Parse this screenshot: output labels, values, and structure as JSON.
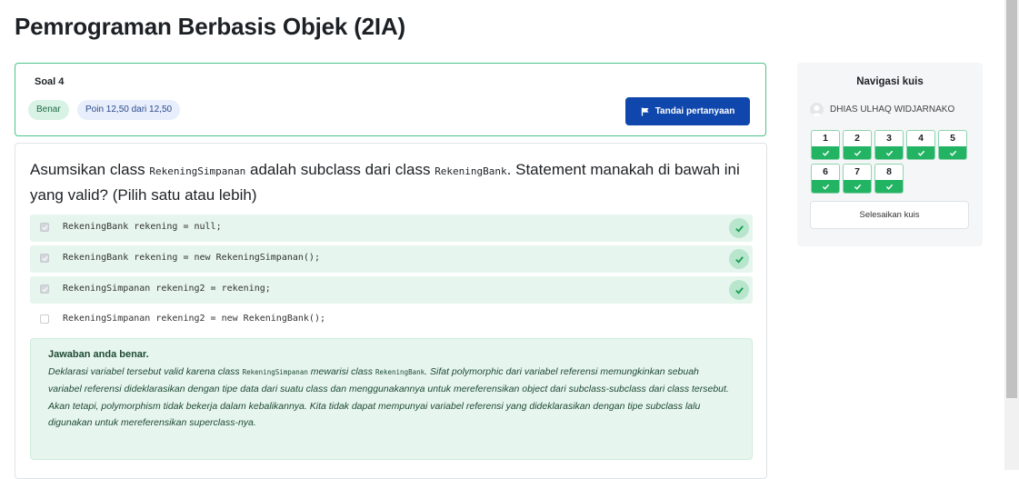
{
  "page": {
    "title": "Pemrograman Berbasis Objek (2IA)"
  },
  "question_info": {
    "number_label": "Soal 4",
    "status": "Benar",
    "points": "Poin 12,50 dari 12,50",
    "flag_label": "Tandai pertanyaan"
  },
  "question": {
    "text_before": "Asumsikan class ",
    "class1": "RekeningSimpanan",
    "text_middle": " adalah subclass dari class ",
    "class2": "RekeningBank",
    "text_after": ". Statement manakah di bawah ini yang valid? (Pilih satu atau lebih)",
    "options": [
      {
        "code": "RekeningBank rekening = null;",
        "checked": true,
        "correct": true
      },
      {
        "code": "RekeningBank rekening = new RekeningSimpanan();",
        "checked": true,
        "correct": true
      },
      {
        "code": "RekeningSimpanan rekening2 = rekening;",
        "checked": true,
        "correct": true
      },
      {
        "code": "RekeningSimpanan rekening2 = new RekeningBank();",
        "checked": false,
        "correct": false
      }
    ]
  },
  "feedback": {
    "title": "Jawaban anda benar.",
    "part1": "Deklarasi variabel tersebut valid karena class ",
    "code1": "RekeningSimpanan",
    "part2": " mewarisi class ",
    "code2": "RekeningBank",
    "part3": ". Sifat polymorphic dari variabel referensi memungkinkan sebuah variabel referensi dideklarasikan dengan tipe data dari suatu class dan menggunakannya untuk mereferensikan object dari subclass-subclass dari class tersebut. Akan tetapi, polymorphism tidak bekerja dalam kebalikannya. Kita tidak dapat mempunyai variabel referensi yang dideklarasikan dengan tipe subclass lalu digunakan untuk mereferensikan superclass-nya."
  },
  "navigation": {
    "title": "Navigasi kuis",
    "user_name": "DHIAS ULHAQ WIDJARNAKO",
    "questions": [
      {
        "label": "1",
        "state": "correct"
      },
      {
        "label": "2",
        "state": "correct"
      },
      {
        "label": "3",
        "state": "correct"
      },
      {
        "label": "4",
        "state": "correct"
      },
      {
        "label": "5",
        "state": "correct"
      },
      {
        "label": "6",
        "state": "correct"
      },
      {
        "label": "7",
        "state": "correct"
      },
      {
        "label": "8",
        "state": "correct"
      }
    ],
    "finish_label": "Selesaikan kuis"
  },
  "colors": {
    "accent": "#0f47ad",
    "success": "#22b363",
    "success_bg": "#e6f5ee"
  },
  "icons": {
    "flag": "flag-icon",
    "check": "check-icon",
    "avatar": "user-avatar-icon"
  }
}
